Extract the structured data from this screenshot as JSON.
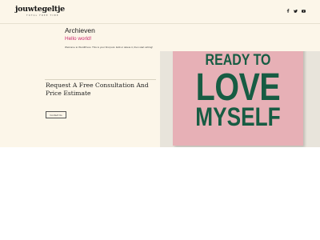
{
  "header": {
    "logo": "jouwtegeltje",
    "tagline": "TOTAL FREE TIME",
    "social_icons": [
      "facebook-icon",
      "twitter-icon",
      "youtube-icon"
    ]
  },
  "archive": {
    "title": "Archieven",
    "post_title": "Hello world!",
    "excerpt": "Welcome to WordPress. This is your first post. Edit or delete it, then start writing!"
  },
  "hero": {
    "heading": "Request A Free Consultation And Price Estimate",
    "button_label": "Contact Us"
  },
  "photo": {
    "sign_lines": [
      "READY TO",
      "LOVE",
      "MYSELF"
    ]
  },
  "colors": {
    "cream_background": "#fcf6e9",
    "link_pink": "#cc2a6e",
    "sign_pink": "#e7b0b6",
    "sign_green": "#175c43"
  }
}
